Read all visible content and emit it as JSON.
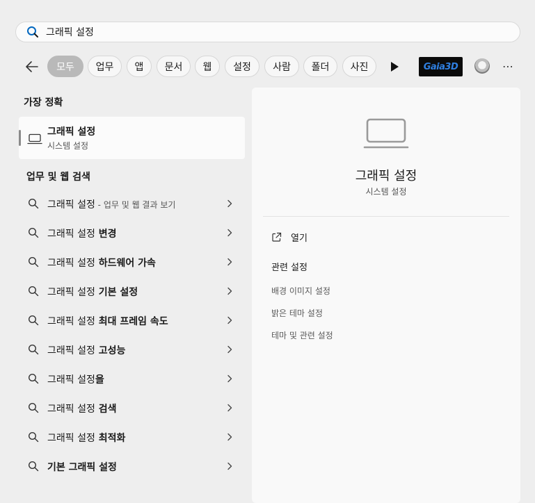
{
  "search": {
    "value": "그래픽 설정"
  },
  "filters": [
    {
      "label": "모두",
      "active": true
    },
    {
      "label": "업무"
    },
    {
      "label": "앱"
    },
    {
      "label": "문서"
    },
    {
      "label": "웹"
    },
    {
      "label": "설정"
    },
    {
      "label": "사람"
    },
    {
      "label": "폴더"
    },
    {
      "label": "사진"
    }
  ],
  "logo_text": "Gaia3D",
  "best_match": {
    "heading": "가장 정확",
    "title": "그래픽 설정",
    "subtitle": "시스템 설정"
  },
  "web_search": {
    "heading": "업무 및 웹 검색",
    "items": [
      {
        "main": "그래픽 설정",
        "rest": "",
        "note": " - 업무 및 웹 결과 보기"
      },
      {
        "main": "그래픽 설정",
        "rest": " 변경",
        "note": ""
      },
      {
        "main": "그래픽 설정",
        "rest": " 하드웨어 가속",
        "note": ""
      },
      {
        "main": "그래픽 설정",
        "rest": " 기본 설정",
        "note": ""
      },
      {
        "main": "그래픽 설정",
        "rest": " 최대 프레임 속도",
        "note": ""
      },
      {
        "main": "그래픽 설정",
        "rest": " 고성능",
        "note": ""
      },
      {
        "main": "그래픽 설정",
        "rest": "을",
        "note": ""
      },
      {
        "main": "그래픽 설정",
        "rest": " 검색",
        "note": ""
      },
      {
        "main": "그래픽 설정",
        "rest": " 최적화",
        "note": ""
      },
      {
        "main": "",
        "rest": "기본 그래픽 설정",
        "note": ""
      }
    ]
  },
  "detail": {
    "title": "그래픽 설정",
    "subtitle": "시스템 설정",
    "open_label": "열기",
    "related_heading": "관련 설정",
    "related_links": [
      "배경 이미지 설정",
      "밝은 테마 설정",
      "테마 및 관련 설정"
    ]
  },
  "colors": {
    "active_chip": "#b9b9b9",
    "accent": "#0067c0"
  }
}
